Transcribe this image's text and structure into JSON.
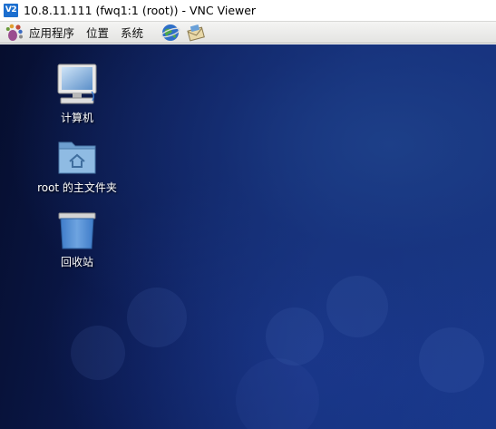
{
  "window": {
    "title": "10.8.11.111 (fwq1:1 (root)) - VNC Viewer",
    "logo_text": "V2"
  },
  "panel": {
    "menus": [
      "应用程序",
      "位置",
      "系统"
    ],
    "icons": [
      "gnome-foot-icon",
      "web-browser-icon",
      "mail-icon"
    ]
  },
  "desktop": {
    "icons": [
      {
        "label": "计算机",
        "icon": "computer-icon"
      },
      {
        "label": "root 的主文件夹",
        "icon": "home-folder-icon"
      },
      {
        "label": "回收站",
        "icon": "trash-icon"
      }
    ]
  }
}
